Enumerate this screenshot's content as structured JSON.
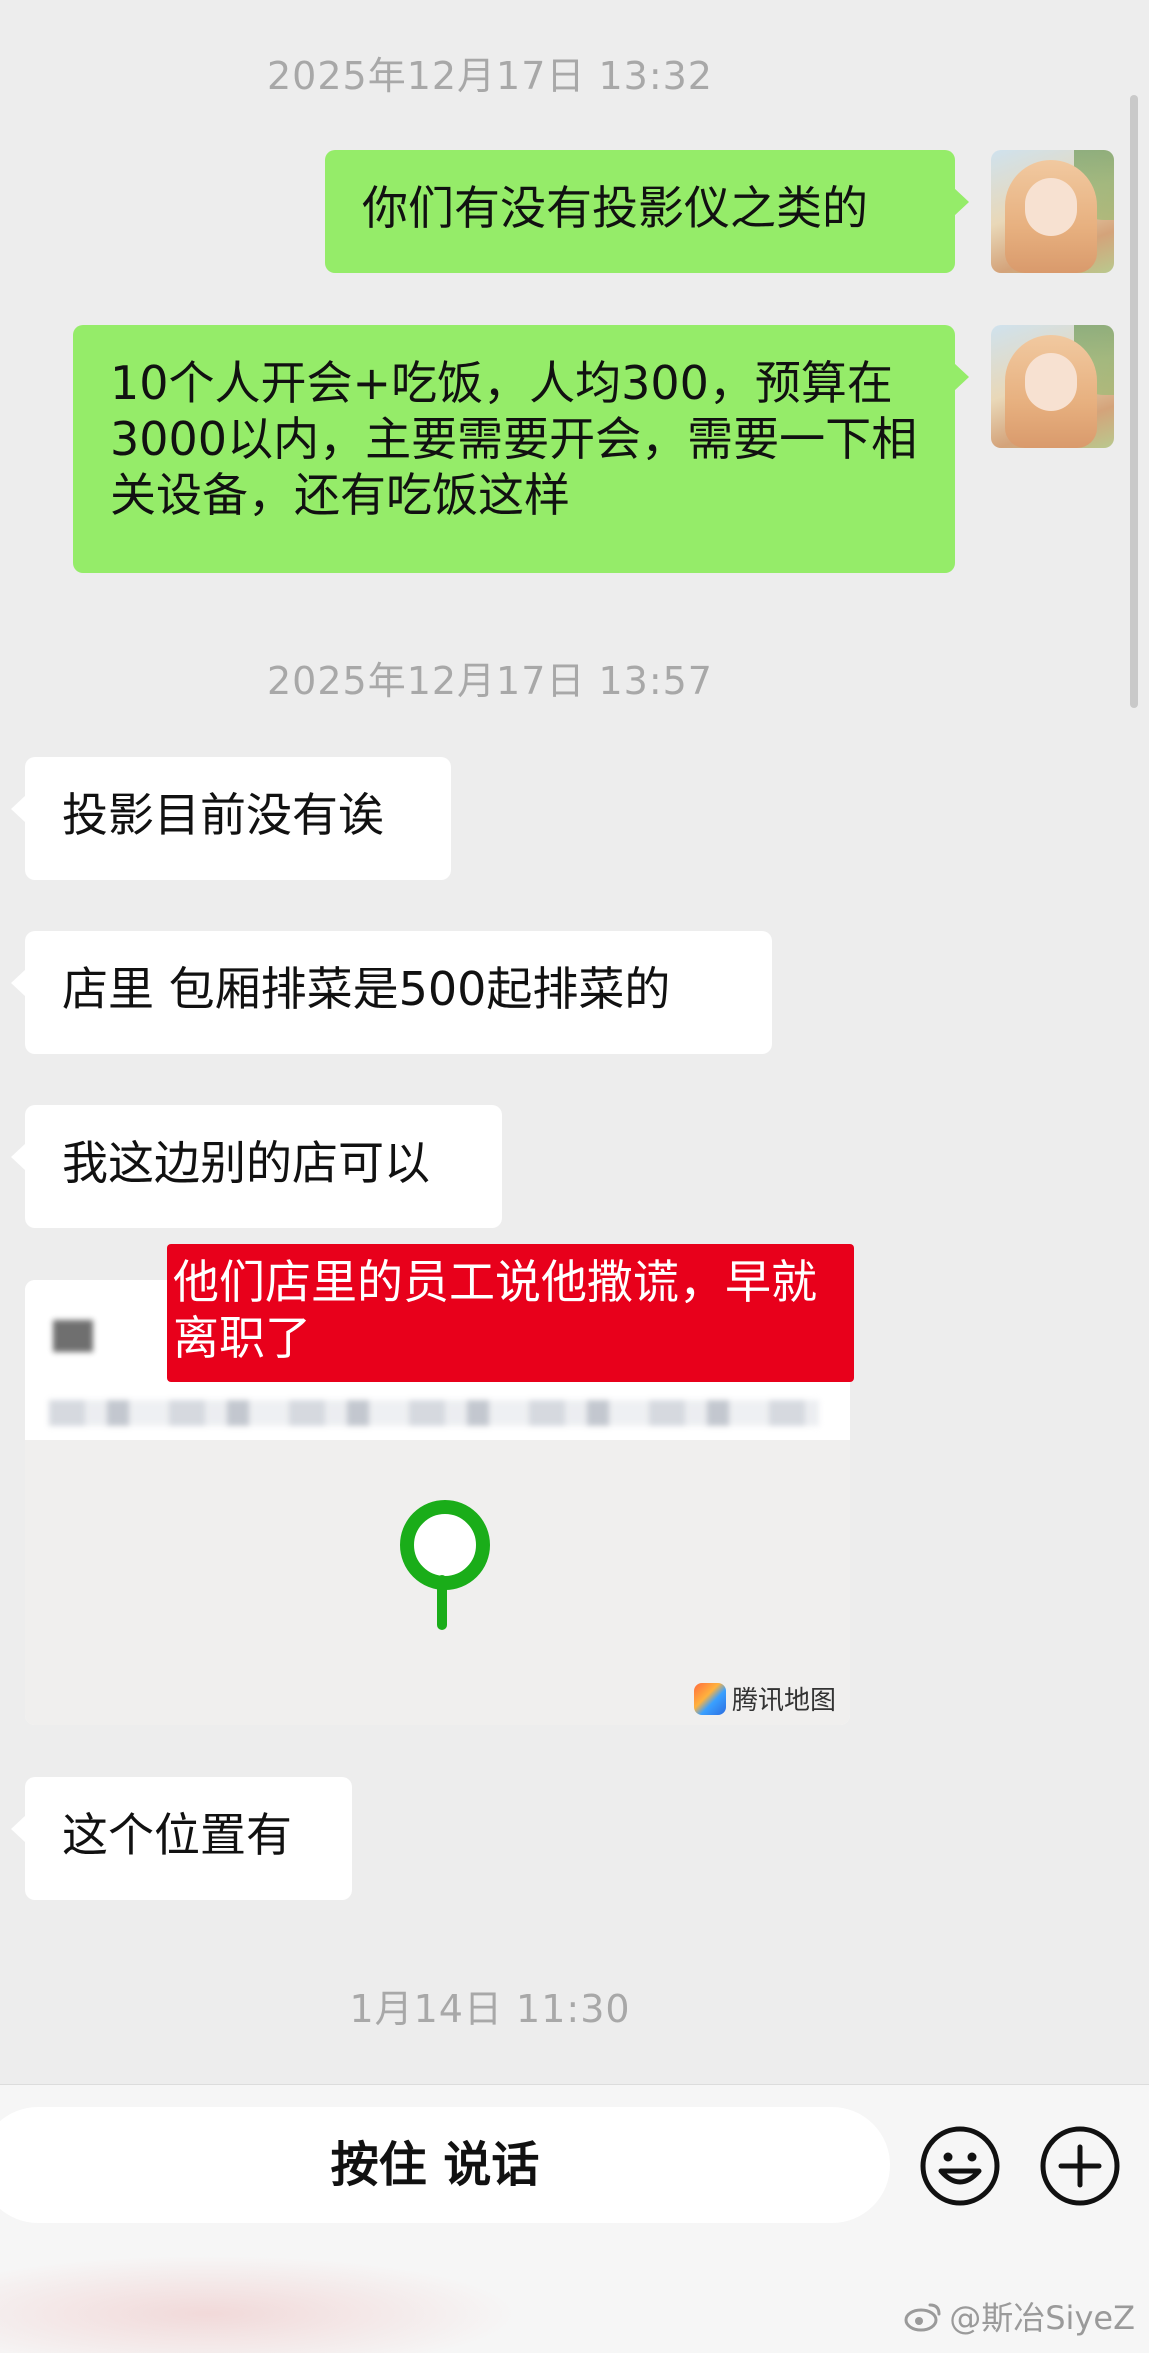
{
  "messages": {
    "ts1": "2025年12月17日 13:32",
    "me1": "你们有没有投影仪之类的",
    "me2": "10个人开会+吃饭，人均300，预算在3000以内，主要需要开会，需要一下相关设备，还有吃饭这样",
    "ts2": "2025年12月17日 13:57",
    "other1": "投影目前没有诶",
    "other2": "店里 包厢排菜是500起排菜的",
    "other3": "我这边别的店可以",
    "location": {
      "map_provider": "腾讯地图"
    },
    "overlay_note": "他们店里的员工说他撒谎，早就离职了",
    "other4": "这个位置有",
    "ts3": "1月14日 11:30"
  },
  "input_bar": {
    "hold_to_talk": "按住 说话",
    "emoji_icon": "emoji-icon",
    "plus_icon": "plus-icon"
  },
  "watermark": "@斯冶SiyeZ",
  "colors": {
    "background": "#ededed",
    "my_bubble": "#95ec69",
    "other_bubble": "#ffffff",
    "overlay_red": "#e8001b",
    "pin_green": "#1aad19"
  }
}
